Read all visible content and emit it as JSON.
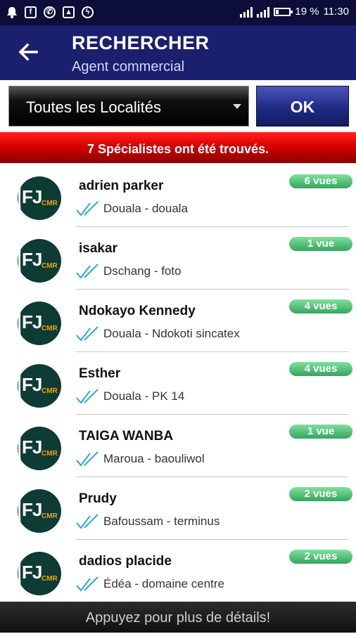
{
  "status_bar": {
    "battery": "19 %",
    "time": "11:30",
    "icons": [
      "bell-icon",
      "facebook-icon",
      "whatsapp-icon",
      "image-icon",
      "power-icon"
    ]
  },
  "app_bar": {
    "title": "RECHERCHER",
    "subtitle": "Agent commercial",
    "back_icon": "arrow-left-icon"
  },
  "filter": {
    "locality_selected": "Toutes les Localités",
    "ok_label": "OK"
  },
  "results_banner": "7 Spécialistes ont été trouvés.",
  "specialists": [
    {
      "name": "adrien parker",
      "location": "Douala - douala",
      "views": "6 vues"
    },
    {
      "name": "isakar",
      "location": "Dschang - foto",
      "views": "1 vue"
    },
    {
      "name": "Ndokayo Kennedy",
      "location": "Douala - Ndokoti sincatex",
      "views": "4 vues"
    },
    {
      "name": "Esther",
      "location": "Douala - PK 14",
      "views": "4 vues"
    },
    {
      "name": "TAIGA WANBA",
      "location": "Maroua - baouliwol",
      "views": "1 vue"
    },
    {
      "name": "Prudy",
      "location": "Bafoussam - terminus",
      "views": "2 vues"
    },
    {
      "name": "dadios placide",
      "location": "Édéa - domaine centre",
      "views": "2 vues"
    }
  ],
  "avatar_logo": {
    "main": "FJ",
    "sub": "CMR"
  },
  "footer_hint": "Appuyez pour plus de détails!",
  "colors": {
    "app_bar": "#1a1f6e",
    "banner_red": "#d60000",
    "badge_green": "#4cb96e",
    "check_blue": "#2aa8d8"
  }
}
